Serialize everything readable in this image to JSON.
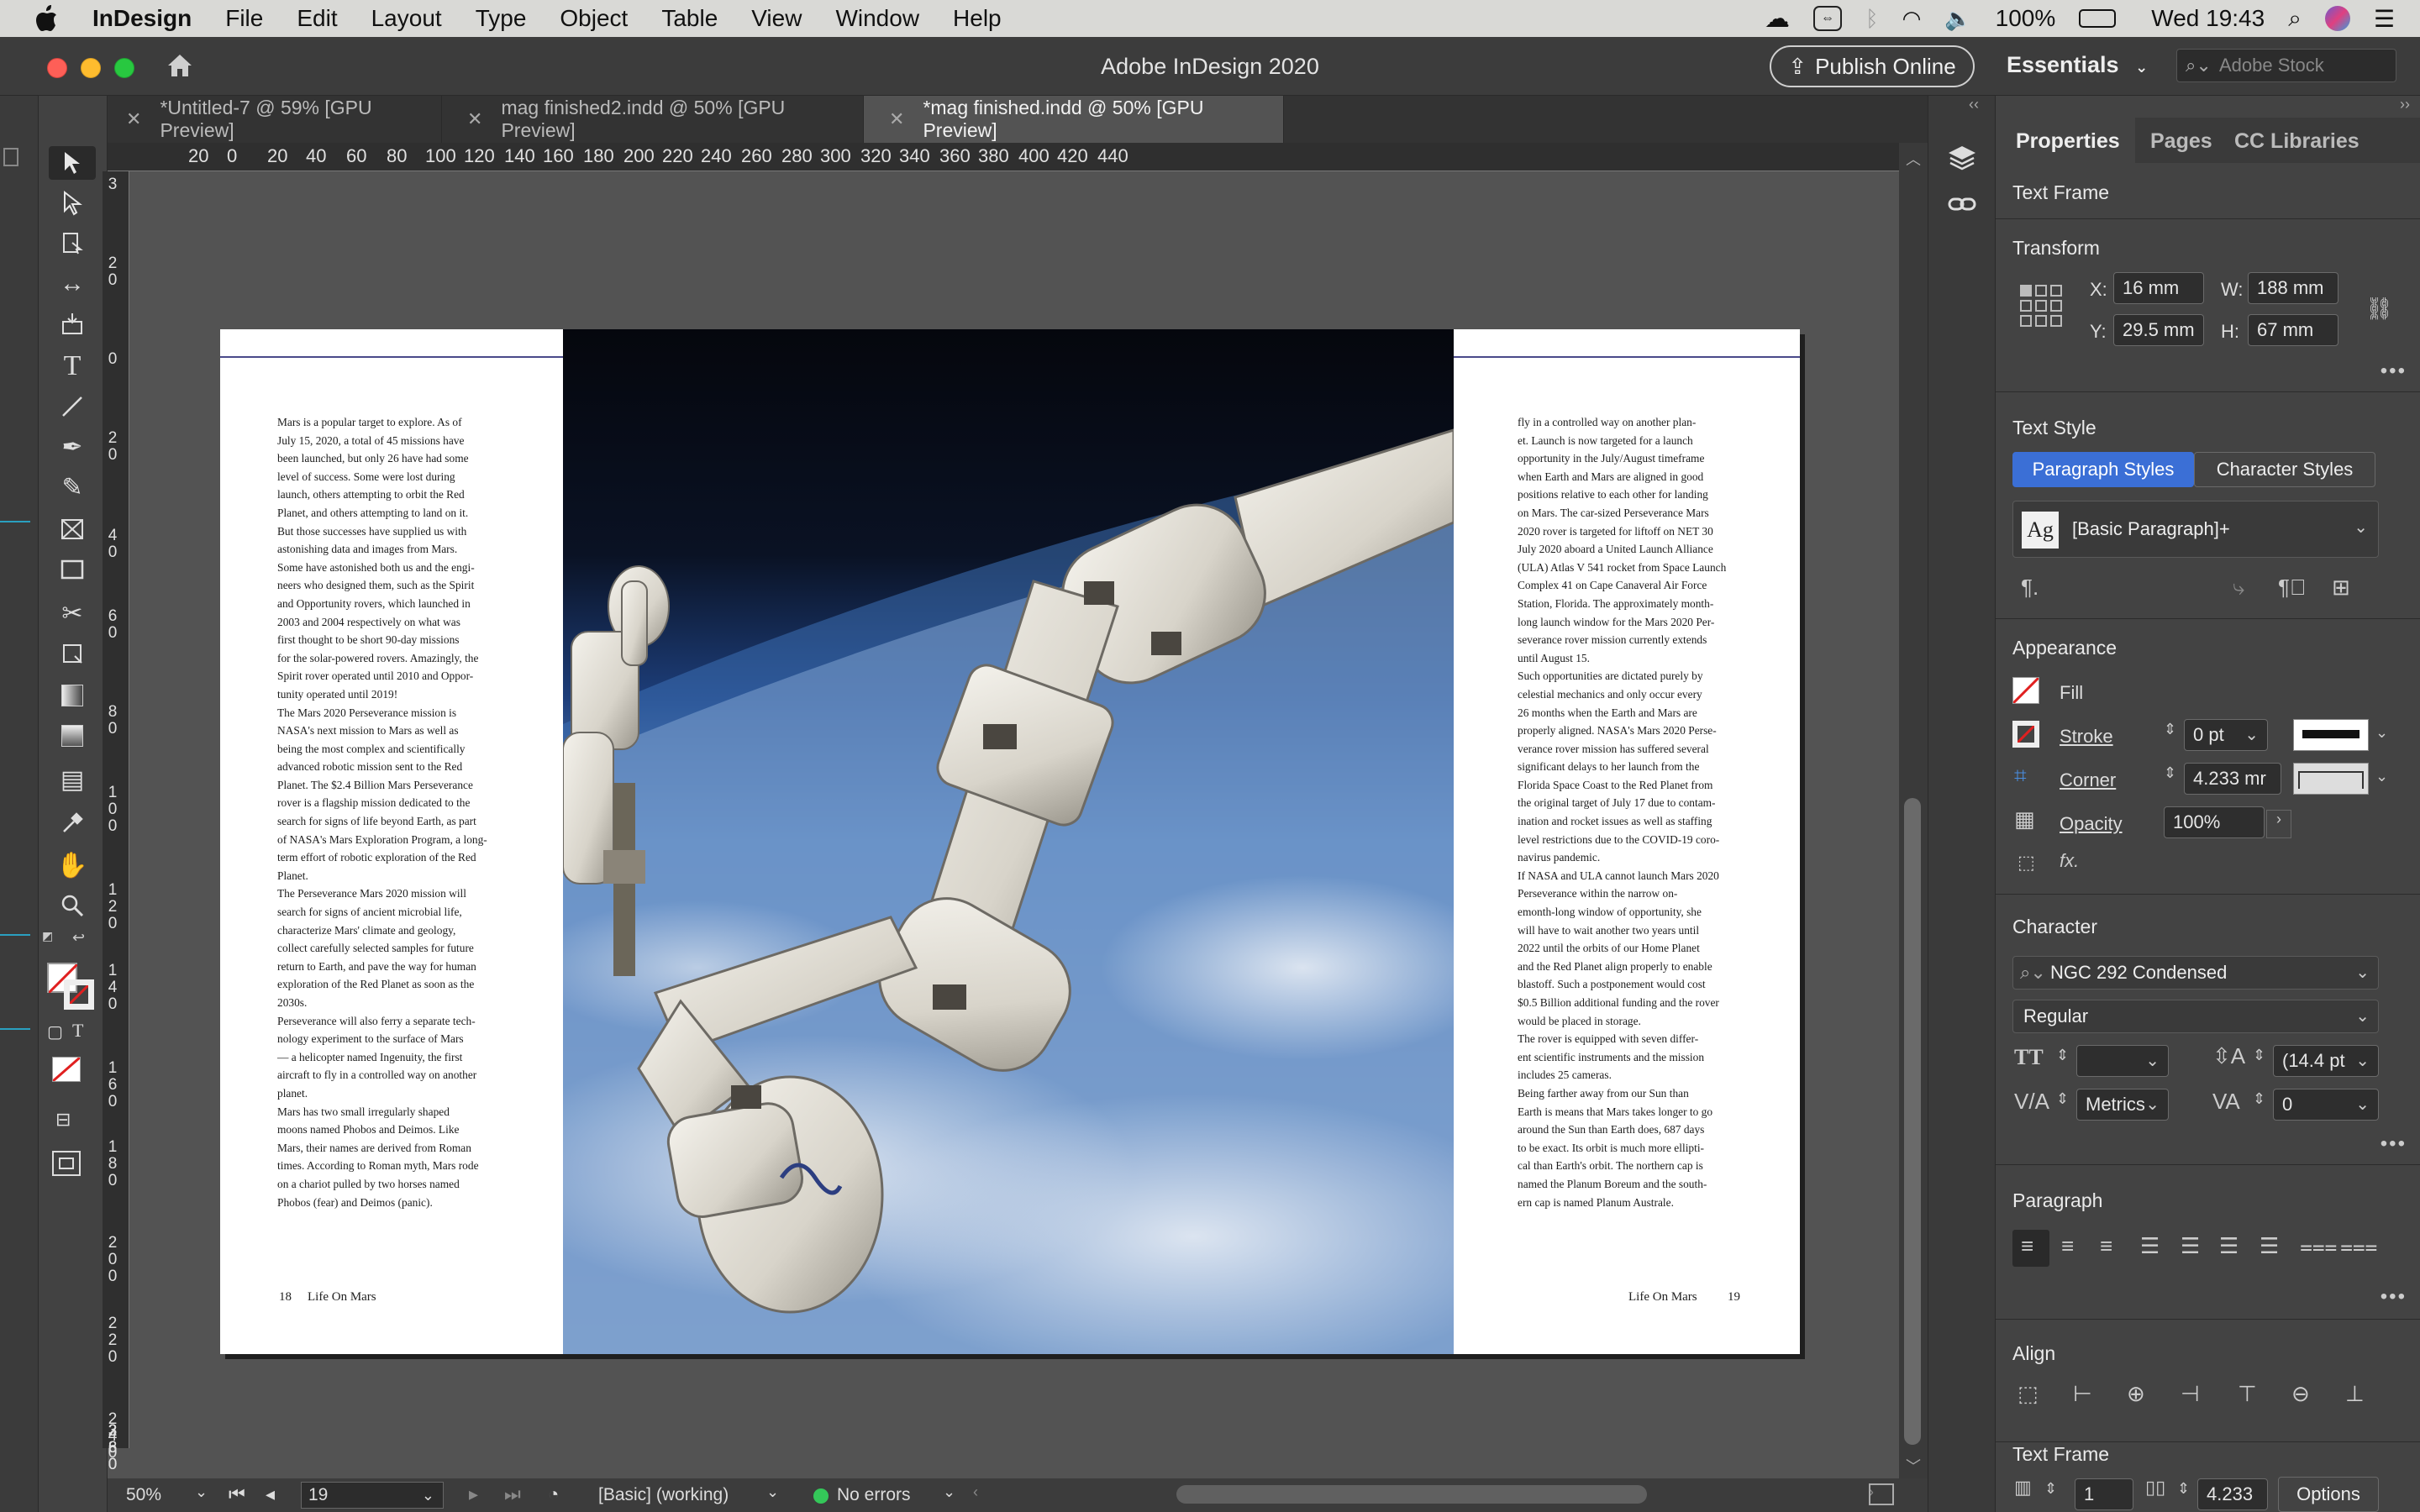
{
  "menubar": {
    "app_name": "InDesign",
    "items": [
      "File",
      "Edit",
      "Layout",
      "Type",
      "Object",
      "Table",
      "View",
      "Window",
      "Help"
    ],
    "battery": "100%",
    "clock": "Wed 19:43"
  },
  "window": {
    "title": "Adobe InDesign 2020",
    "publish_label": "Publish Online",
    "workspace": "Essentials",
    "stock_placeholder": "Adobe Stock"
  },
  "tabs": [
    {
      "label": "*Untitled-7 @ 59% [GPU Preview]"
    },
    {
      "label": "mag finished2.indd @ 50% [GPU Preview]"
    },
    {
      "label": "*mag finished.indd @ 50% [GPU Preview]"
    }
  ],
  "ruler": {
    "h_labels": [
      "20",
      "0",
      "20",
      "40",
      "60",
      "80",
      "100",
      "120",
      "140",
      "160",
      "180",
      "200",
      "220",
      "240",
      "260",
      "280",
      "300",
      "320",
      "340",
      "360",
      "380",
      "400",
      "420",
      "440"
    ],
    "v_labels": [
      "3",
      "20",
      "0",
      "20",
      "40",
      "60",
      "80",
      "100",
      "120",
      "140",
      "160",
      "180",
      "200",
      "220",
      "240",
      "260",
      "280",
      "3"
    ]
  },
  "page": {
    "left_text": "Mars is a popular target to explore. As of\nJuly 15, 2020, a total of 45 missions have\nbeen launched, but only 26 have had some\nlevel of success. Some were lost during\nlaunch, others attempting to orbit the Red\nPlanet, and others attempting to land on it.\nBut those successes have supplied us with\nastonishing data and images from Mars.\nSome have astonished both us and the engi-\nneers who designed them, such as the Spirit\nand Opportunity rovers, which launched in\n2003 and 2004 respectively on what was\nfirst thought to be short 90-day missions\nfor the solar-powered rovers. Amazingly, the\nSpirit rover operated until 2010 and Oppor-\ntunity operated until 2019!\nThe Mars 2020 Perseverance mission is\nNASA's next mission to Mars as well as\nbeing the most complex and scientifically\nadvanced robotic mission sent to the Red\nPlanet. The $2.4 Billion Mars Perseverance\nrover is a flagship mission dedicated to the\nsearch for signs of life beyond Earth, as part\nof NASA's Mars Exploration Program, a long-\nterm effort of robotic exploration of the Red\nPlanet.\nThe Perseverance Mars 2020 mission will\nsearch for signs of ancient microbial life,\ncharacterize Mars' climate and geology,\ncollect carefully selected samples for future\nreturn to Earth, and pave the way for human\nexploration of the Red Planet as soon as the\n2030s.\nPerseverance will also ferry a separate tech-\nnology experiment to the surface of Mars\n— a helicopter named Ingenuity, the first\naircraft to fly in a controlled way on another\nplanet.\nMars has two small irregularly shaped\nmoons named Phobos and Deimos. Like\nMars, their names are derived from Roman\ntimes. According to Roman myth, Mars rode\non a chariot pulled by two horses named\nPhobos (fear) and Deimos (panic).",
    "right_text": "fly in a controlled way on another plan-\net. Launch is now targeted for a launch\nopportunity in the July/August timeframe\nwhen Earth and Mars are aligned in good\npositions relative to each other for landing\non Mars. The car-sized Perseverance Mars\n2020 rover is targeted for liftoff on NET 30\nJuly 2020 aboard a United Launch Alliance\n(ULA) Atlas V 541 rocket from Space Launch\nComplex 41 on Cape Canaveral Air Force\nStation, Florida. The approximately month-\nlong launch window for the Mars 2020 Per-\nseverance rover mission currently extends\nuntil August 15.\nSuch opportunities are dictated purely by\ncelestial mechanics and only occur every\n26 months when the Earth and Mars are\nproperly aligned. NASA's Mars 2020 Perse-\nverance rover mission has suffered several\nsignificant delays to her launch from the\nFlorida Space Coast to the Red Planet from\nthe original target of July 17 due to contam-\nination and rocket issues as well as staffing\nlevel restrictions due to the COVID-19 coro-\nnavirus pandemic.\nIf NASA and ULA cannot launch Mars 2020\nPerseverance within the narrow on-\nemonth-long window of opportunity, she\nwill have to wait another two years until\n2022 until the orbits of our Home Planet\nand the Red Planet align properly to enable\nblastoff. Such a postponement would cost\n$0.5 Billion additional funding and the rover\nwould be placed in storage.\nThe rover is equipped with seven differ-\nent scientific instruments and the mission\nincludes 25 cameras.\nBeing farther away from our Sun than\nEarth is means that Mars takes longer to go\naround the Sun than Earth does, 687 days\nto be exact. Its orbit is much more ellipti-\ncal than Earth's orbit. The northern cap is\nnamed the Planum Boreum and the south-\nern cap is named Planum Australe.",
    "left_folio_num": "18",
    "left_folio_title": "Life On Mars",
    "right_folio_title": "Life On Mars",
    "right_folio_num": "19"
  },
  "status": {
    "zoom": "50%",
    "page": "19",
    "style": "[Basic] (working)",
    "preflight": "No errors"
  },
  "panel": {
    "tabs": [
      "Properties",
      "Pages",
      "CC Libraries"
    ],
    "object_type": "Text Frame",
    "transform": {
      "title": "Transform",
      "x_label": "X:",
      "x": "16 mm",
      "y_label": "Y:",
      "y": "29.5 mm",
      "w_label": "W:",
      "w": "188 mm",
      "h_label": "H:",
      "h": "67 mm"
    },
    "text_style": {
      "title": "Text Style",
      "para_btn": "Paragraph Styles",
      "char_btn": "Character Styles",
      "style": "[Basic Paragraph]+",
      "ag": "Ag"
    },
    "appearance": {
      "title": "Appearance",
      "fill": "Fill",
      "stroke": "Stroke",
      "stroke_val": "0 pt",
      "corner": "Corner",
      "corner_val": "4.233 mr",
      "opacity": "Opacity",
      "opacity_val": "100%"
    },
    "character": {
      "title": "Character",
      "font": "NGC 292 Condensed",
      "weight": "Regular",
      "size": "",
      "leading": "(14.4 pt",
      "kerning": "Metrics",
      "tracking": "0"
    },
    "paragraph": {
      "title": "Paragraph"
    },
    "align": {
      "title": "Align"
    },
    "text_frame": {
      "title": "Text Frame",
      "columns": "1",
      "gutter": "4.233",
      "options": "Options"
    }
  },
  "colors": {
    "accent": "#3b6fd6",
    "pasteboard": "#535353",
    "panel": "#434343"
  }
}
